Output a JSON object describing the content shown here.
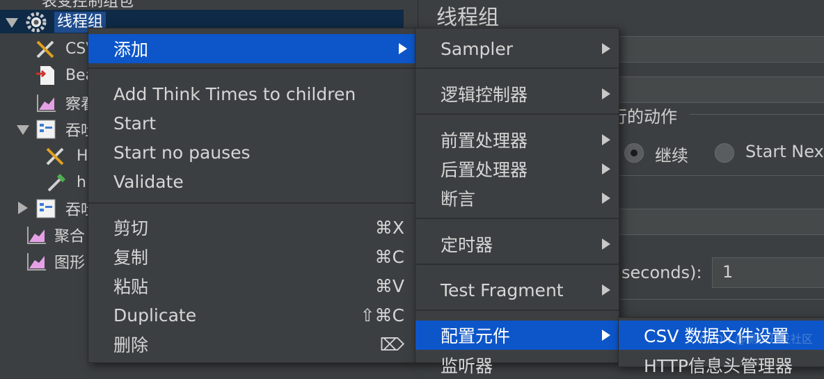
{
  "tree": {
    "top_partial": "表变控制组包",
    "selected": "线程组",
    "items": [
      {
        "label": "CSV"
      },
      {
        "label": "Bea"
      },
      {
        "label": "察看"
      },
      {
        "label": "吞吐"
      },
      {
        "label": "H"
      },
      {
        "label": "h"
      },
      {
        "label": "吞吐"
      },
      {
        "label": "聚合"
      },
      {
        "label": "图形"
      }
    ]
  },
  "panel": {
    "title": "线程组",
    "action_label": "行的动作",
    "radio_continue": "继续",
    "radio_start_next": "Start Nex",
    "seconds_label": "seconds):",
    "seconds_value": "1"
  },
  "context_menu": {
    "add": "添加",
    "add_think_times": "Add Think Times to children",
    "start": "Start",
    "start_no_pauses": "Start no pauses",
    "validate": "Validate",
    "cut": "剪切",
    "cut_shortcut": "⌘X",
    "copy": "复制",
    "copy_shortcut": "⌘C",
    "paste": "粘贴",
    "paste_shortcut": "⌘V",
    "duplicate": "Duplicate",
    "duplicate_shortcut": "⇧⌘C",
    "delete": "删除",
    "delete_shortcut": "⌦"
  },
  "add_submenu": {
    "sampler": "Sampler",
    "logic_controller": "逻辑控制器",
    "pre_processor": "前置处理器",
    "post_processor": "后置处理器",
    "assertion": "断言",
    "timer": "定时器",
    "test_fragment": "Test Fragment",
    "config_element": "配置元件",
    "listener_partial": "监听器"
  },
  "config_submenu": {
    "csv_data_set": "CSV 数据文件设置",
    "next_partial": "HTTP信息头管理器"
  },
  "watermark": "CSDN @测试开发社区"
}
